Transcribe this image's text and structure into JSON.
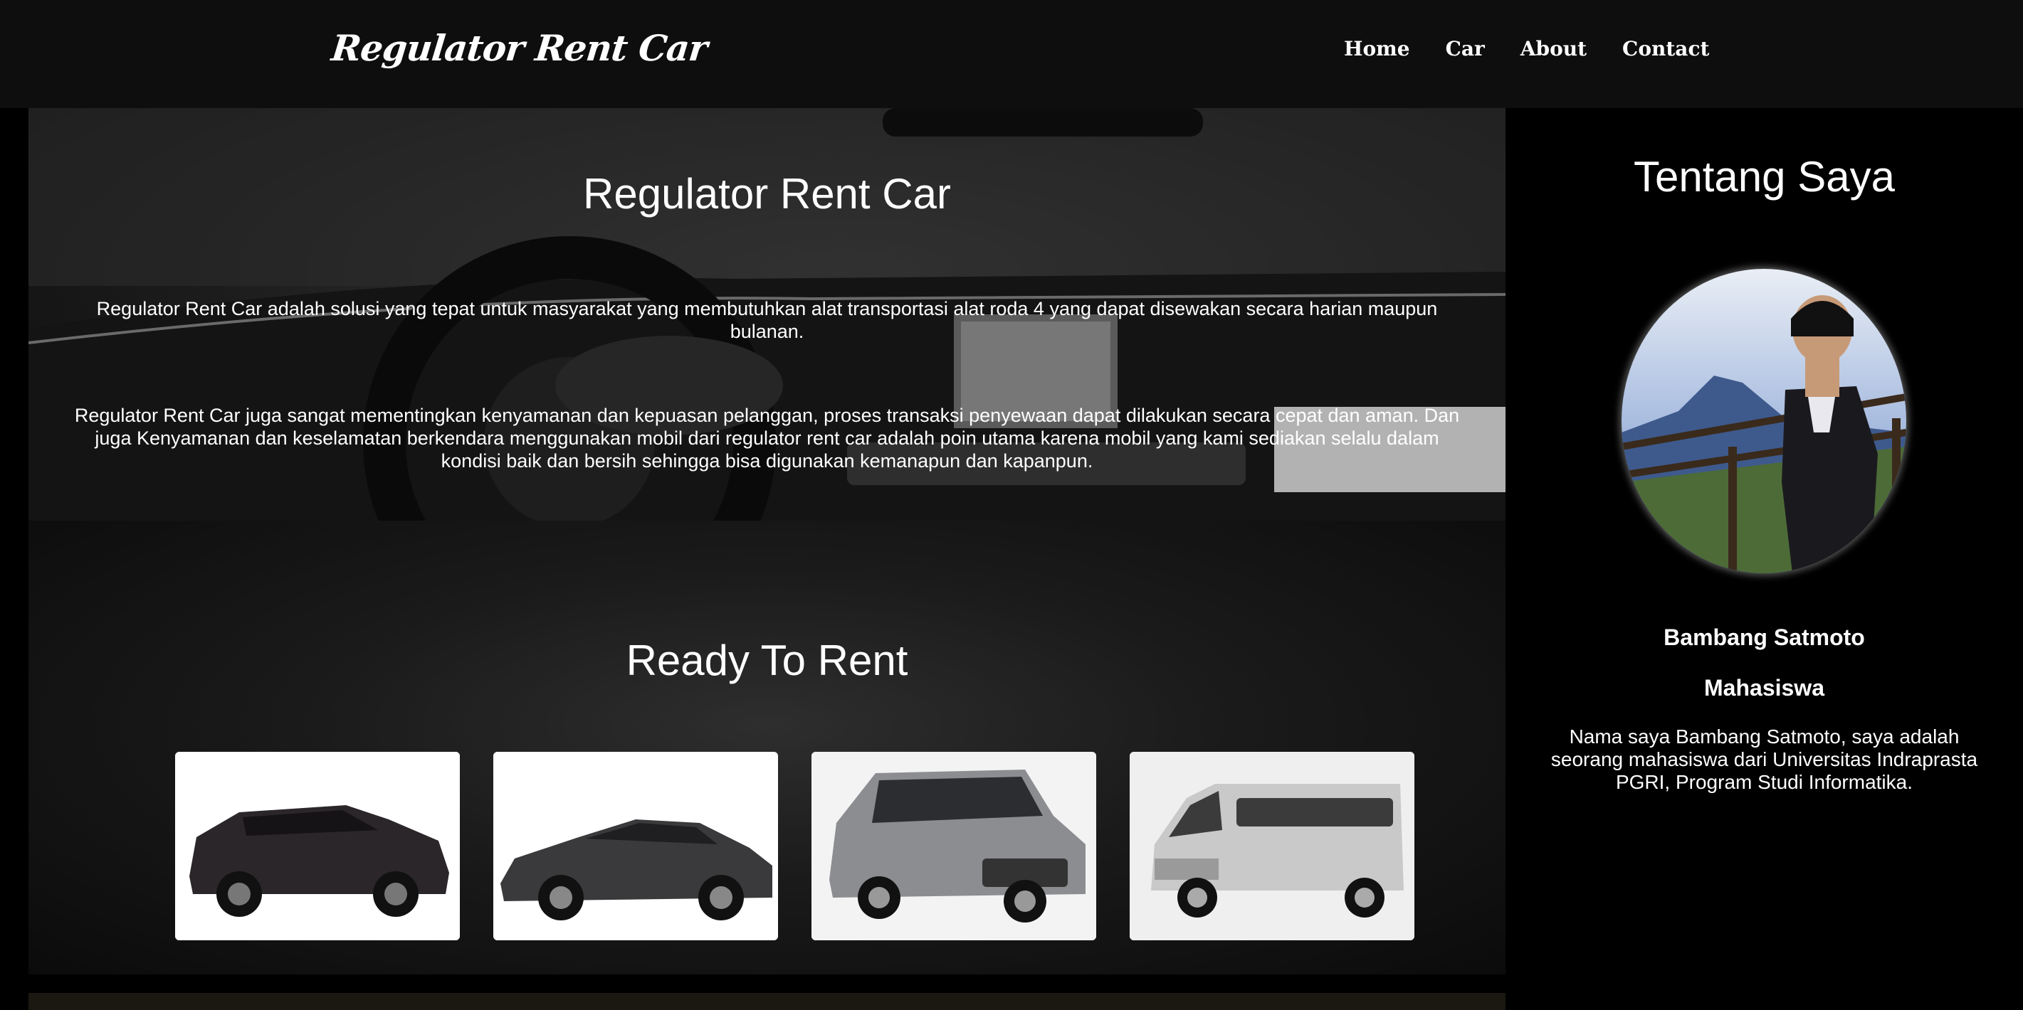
{
  "navbar": {
    "brand": "Regulator Rent Car",
    "links": [
      {
        "label": "Home"
      },
      {
        "label": "Car"
      },
      {
        "label": "About"
      },
      {
        "label": "Contact"
      }
    ]
  },
  "hero": {
    "title": "Regulator Rent Car",
    "paragraph1": "Regulator Rent Car adalah solusi yang tepat untuk masyarakat yang membutuhkan alat transportasi alat roda 4 yang dapat disewakan secara harian maupun bulanan.",
    "paragraph2": "Regulator Rent Car juga sangat mementingkan kenyamanan dan kepuasan pelanggan, proses transaksi penyewaan dapat dilakukan secara cepat dan aman. Dan juga Kenyamanan dan keselamatan berkendara menggunakan mobil dari regulator rent car adalah poin utama karena mobil yang kami sediakan selalu dalam kondisi baik dan bersih sehingga bisa digunakan kemanapun dan kapanpun."
  },
  "rent": {
    "title": "Ready To Rent",
    "cars": [
      {
        "icon": "suv-dark-image",
        "color": "#2a2629"
      },
      {
        "icon": "sedan-dark-image",
        "color": "#3a3a3c"
      },
      {
        "icon": "mpv-silver-image",
        "color": "#8c8d91"
      },
      {
        "icon": "van-white-image",
        "color": "#c9c9c9"
      }
    ]
  },
  "sidebar": {
    "title": "Tentang Saya",
    "name": "Bambang Satmoto",
    "role": "Mahasiswa",
    "description": "Nama saya Bambang Satmoto, saya adalah seorang mahasiswa dari Universitas Indraprasta PGRI, Program Studi Informatika."
  }
}
